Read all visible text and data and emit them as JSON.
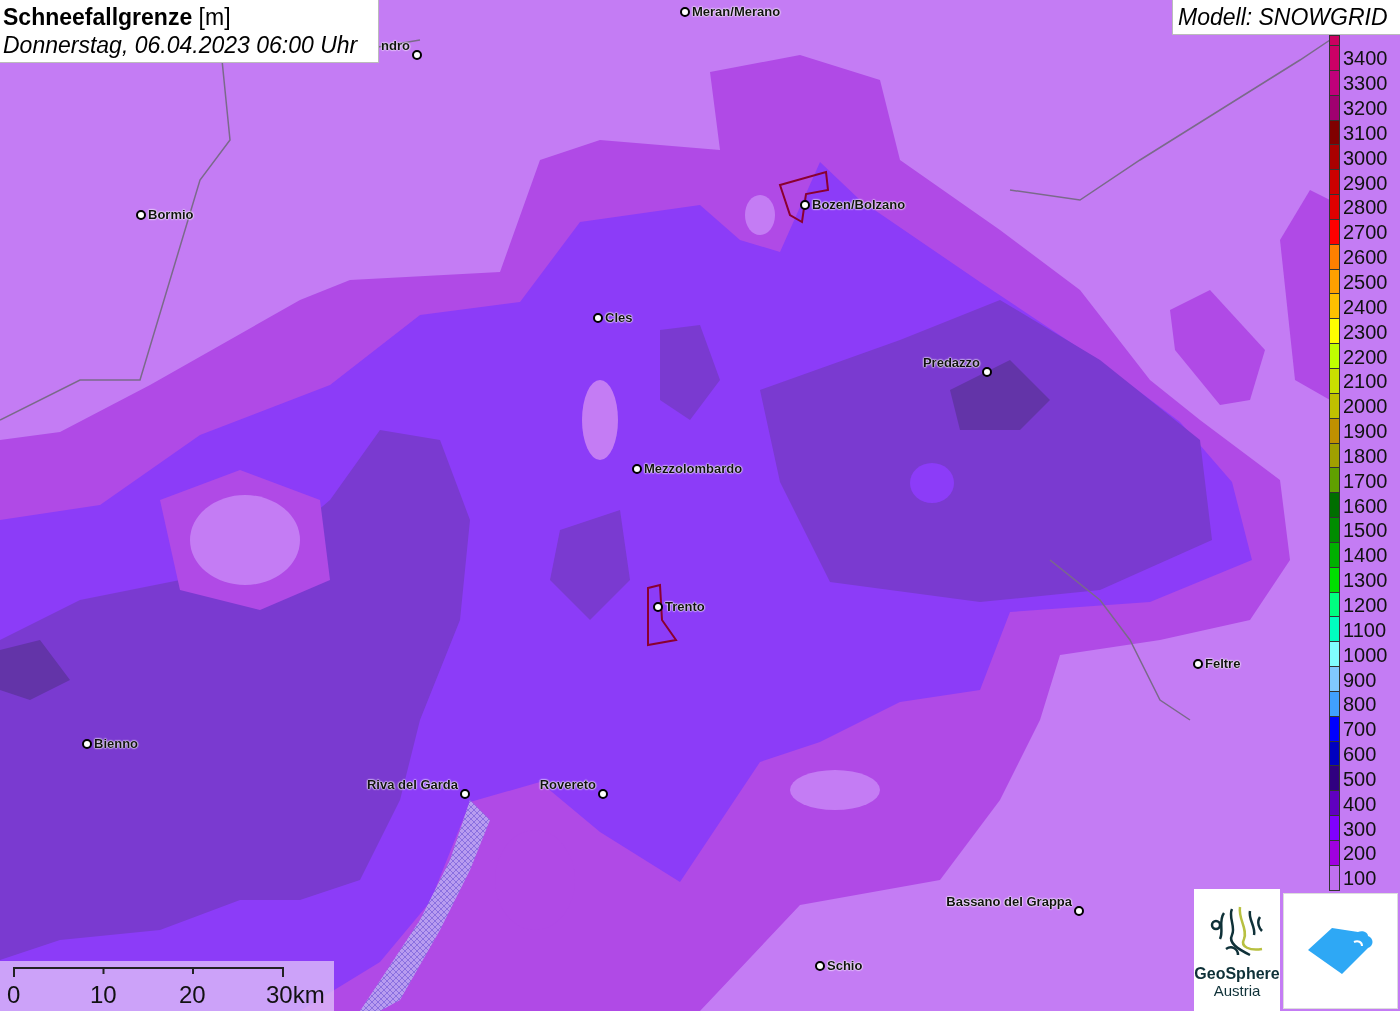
{
  "title": {
    "heading": "**Schneefallgrenze** [m]",
    "date": "Donnerstag, 06.04.2023 06:00 Uhr"
  },
  "model": "Modell: SNOWGRID",
  "places": [
    {
      "name": "Meran/Merano",
      "kind": "right"
    },
    {
      "name": "ndro",
      "kind": "left"
    },
    {
      "name": "Bormio",
      "kind": "right"
    },
    {
      "name": "Bozen/Bolzano",
      "kind": "right"
    },
    {
      "name": "Cles",
      "kind": "right"
    },
    {
      "name": "Predazzo",
      "kind": "left"
    },
    {
      "name": "Mezzolombardo",
      "kind": "right"
    },
    {
      "name": "Trento",
      "kind": "right"
    },
    {
      "name": "Feltre",
      "kind": "right"
    },
    {
      "name": "Bienno",
      "kind": "right"
    },
    {
      "name": "Riva del Garda",
      "kind": "left"
    },
    {
      "name": "Rovereto",
      "kind": "left"
    },
    {
      "name": "Bassano del Grappa",
      "kind": "left"
    },
    {
      "name": "Schio",
      "kind": "right"
    }
  ],
  "legend": [
    {
      "label": "3400",
      "color": "#cc0066"
    },
    {
      "label": "3300",
      "color": "#c0007a"
    },
    {
      "label": "3200",
      "color": "#a00070"
    },
    {
      "label": "3100",
      "color": "#800000"
    },
    {
      "label": "3000",
      "color": "#aa0000"
    },
    {
      "label": "2900",
      "color": "#cc0000"
    },
    {
      "label": "2800",
      "color": "#e00000"
    },
    {
      "label": "2700",
      "color": "#ff0000"
    },
    {
      "label": "2600",
      "color": "#ff8000"
    },
    {
      "label": "2500",
      "color": "#ffa000"
    },
    {
      "label": "2400",
      "color": "#ffc000"
    },
    {
      "label": "2300",
      "color": "#ffff00"
    },
    {
      "label": "2200",
      "color": "#c0ff00"
    },
    {
      "label": "2100",
      "color": "#c8e000"
    },
    {
      "label": "2000",
      "color": "#c0c000"
    },
    {
      "label": "1900",
      "color": "#c09000"
    },
    {
      "label": "1800",
      "color": "#a0a000"
    },
    {
      "label": "1700",
      "color": "#60a000"
    },
    {
      "label": "1600",
      "color": "#006e00"
    },
    {
      "label": "1500",
      "color": "#008c00"
    },
    {
      "label": "1400",
      "color": "#00b000"
    },
    {
      "label": "1300",
      "color": "#00e000"
    },
    {
      "label": "1200",
      "color": "#00ff80"
    },
    {
      "label": "1100",
      "color": "#00ffc0"
    },
    {
      "label": "1000",
      "color": "#80ffff"
    },
    {
      "label": "900",
      "color": "#80c8ff"
    },
    {
      "label": "800",
      "color": "#40a0ff"
    },
    {
      "label": "700",
      "color": "#0000ff"
    },
    {
      "label": "600",
      "color": "#0000c0"
    },
    {
      "label": "500",
      "color": "#300080"
    },
    {
      "label": "400",
      "color": "#6000c0"
    },
    {
      "label": "300",
      "color": "#8000ff"
    },
    {
      "label": "200",
      "color": "#a000e0"
    },
    {
      "label": "100",
      "color": "#c070f0"
    }
  ],
  "scale_bar": [
    "0",
    "10",
    "20",
    "30km"
  ],
  "logo": {
    "name": "GeoSphere",
    "subtitle": "Austria"
  }
}
